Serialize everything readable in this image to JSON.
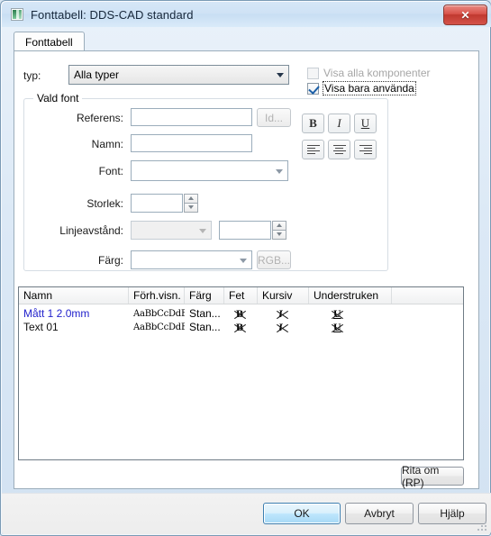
{
  "window": {
    "title": "Fonttabell: DDS-CAD standard",
    "icon": "app-icon",
    "close_label": "✕"
  },
  "tabs": [
    {
      "label": "Fonttabell",
      "active": true
    }
  ],
  "filter": {
    "type_label": "typ:",
    "type_value": "Alla typer",
    "checkbox_all_components": "Visa alla komponenter",
    "checkbox_only_used": "Visa bara använda"
  },
  "selected_font": {
    "caption": "Vald font",
    "reference_label": "Referens:",
    "reference_value": "",
    "id_button": "Id...",
    "name_label": "Namn:",
    "name_value": "",
    "font_label": "Font:",
    "font_value": "",
    "size_label": "Storlek:",
    "size_value": "",
    "linespacing_label": "Linjeavstånd:",
    "linespacing_value": "",
    "linespacing_number": "",
    "color_label": "Färg:",
    "color_value": "",
    "rgb_button": "RGB..."
  },
  "format_toolbar": {
    "bold": "B",
    "italic": "I",
    "underline": "U",
    "align_left": "align-left",
    "align_center": "align-center",
    "align_right": "align-right"
  },
  "table": {
    "columns": [
      "Namn",
      "Förh.visn.",
      "Färg",
      "Fet",
      "Kursiv",
      "Understruken"
    ],
    "rows": [
      {
        "name": "Mått 1  2.0mm",
        "preview": "AaBbCcDdEe",
        "color": "Stan...",
        "bold": "B",
        "italic": "I",
        "underline": "U",
        "name_color": "#2222cc"
      },
      {
        "name": "Text 01",
        "preview": "AaBbCcDdEe",
        "color": "Stan...",
        "bold": "B",
        "italic": "I",
        "underline": "U",
        "name_color": "#101010"
      }
    ]
  },
  "buttons": {
    "redraw": "Rita om (RP)",
    "ok": "OK",
    "cancel": "Avbryt",
    "help": "Hjälp"
  }
}
